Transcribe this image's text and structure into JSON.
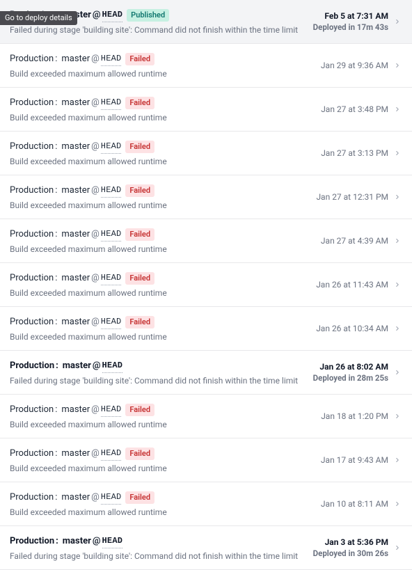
{
  "tooltip_text": "Go to deploy details",
  "deploys": [
    {
      "env": "Production",
      "branch": "master",
      "ref": "HEAD",
      "status": "Published",
      "status_kind": "published",
      "message": "Failed during stage 'building site': Command did not finish within the time limit",
      "timestamp": "Feb 5 at 7:31 AM",
      "duration": "Deployed in 17m 43s",
      "bold": true,
      "show_tooltip": true
    },
    {
      "env": "Production",
      "branch": "master",
      "ref": "HEAD",
      "status": "Failed",
      "status_kind": "failed",
      "message": "Build exceeded maximum allowed runtime",
      "timestamp": "Jan 29 at 9:36 AM",
      "duration": "",
      "bold": false,
      "show_tooltip": false
    },
    {
      "env": "Production",
      "branch": "master",
      "ref": "HEAD",
      "status": "Failed",
      "status_kind": "failed",
      "message": "Build exceeded maximum allowed runtime",
      "timestamp": "Jan 27 at 3:48 PM",
      "duration": "",
      "bold": false,
      "show_tooltip": false
    },
    {
      "env": "Production",
      "branch": "master",
      "ref": "HEAD",
      "status": "Failed",
      "status_kind": "failed",
      "message": "Build exceeded maximum allowed runtime",
      "timestamp": "Jan 27 at 3:13 PM",
      "duration": "",
      "bold": false,
      "show_tooltip": false
    },
    {
      "env": "Production",
      "branch": "master",
      "ref": "HEAD",
      "status": "Failed",
      "status_kind": "failed",
      "message": "Build exceeded maximum allowed runtime",
      "timestamp": "Jan 27 at 12:31 PM",
      "duration": "",
      "bold": false,
      "show_tooltip": false
    },
    {
      "env": "Production",
      "branch": "master",
      "ref": "HEAD",
      "status": "Failed",
      "status_kind": "failed",
      "message": "Build exceeded maximum allowed runtime",
      "timestamp": "Jan 27 at 4:39 AM",
      "duration": "",
      "bold": false,
      "show_tooltip": false
    },
    {
      "env": "Production",
      "branch": "master",
      "ref": "HEAD",
      "status": "Failed",
      "status_kind": "failed",
      "message": "Build exceeded maximum allowed runtime",
      "timestamp": "Jan 26 at 11:43 AM",
      "duration": "",
      "bold": false,
      "show_tooltip": false
    },
    {
      "env": "Production",
      "branch": "master",
      "ref": "HEAD",
      "status": "Failed",
      "status_kind": "failed",
      "message": "Build exceeded maximum allowed runtime",
      "timestamp": "Jan 26 at 10:34 AM",
      "duration": "",
      "bold": false,
      "show_tooltip": false
    },
    {
      "env": "Production",
      "branch": "master",
      "ref": "HEAD",
      "status": "",
      "status_kind": "",
      "message": "Failed during stage 'building site': Command did not finish within the time limit",
      "timestamp": "Jan 26 at 8:02 AM",
      "duration": "Deployed in 28m 25s",
      "bold": true,
      "show_tooltip": false
    },
    {
      "env": "Production",
      "branch": "master",
      "ref": "HEAD",
      "status": "Failed",
      "status_kind": "failed",
      "message": "Build exceeded maximum allowed runtime",
      "timestamp": "Jan 18 at 1:20 PM",
      "duration": "",
      "bold": false,
      "show_tooltip": false
    },
    {
      "env": "Production",
      "branch": "master",
      "ref": "HEAD",
      "status": "Failed",
      "status_kind": "failed",
      "message": "Build exceeded maximum allowed runtime",
      "timestamp": "Jan 17 at 9:43 AM",
      "duration": "",
      "bold": false,
      "show_tooltip": false
    },
    {
      "env": "Production",
      "branch": "master",
      "ref": "HEAD",
      "status": "Failed",
      "status_kind": "failed",
      "message": "Build exceeded maximum allowed runtime",
      "timestamp": "Jan 10 at 8:11 AM",
      "duration": "",
      "bold": false,
      "show_tooltip": false
    },
    {
      "env": "Production",
      "branch": "master",
      "ref": "HEAD",
      "status": "",
      "status_kind": "",
      "message": "Failed during stage 'building site': Command did not finish within the time limit",
      "timestamp": "Jan 3 at 5:36 PM",
      "duration": "Deployed in 30m 26s",
      "bold": true,
      "show_tooltip": false
    }
  ]
}
